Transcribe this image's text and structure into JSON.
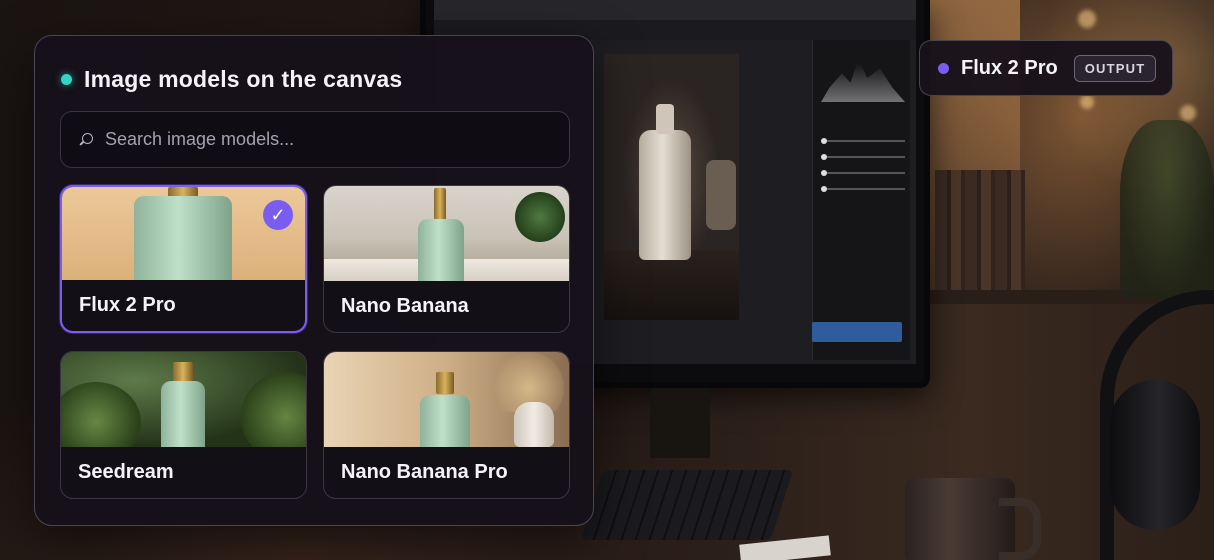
{
  "panel": {
    "title": "Image models on the canvas",
    "status_color": "#33d6c3",
    "search": {
      "placeholder": "Search image models..."
    },
    "models": [
      {
        "name": "Flux 2 Pro",
        "selected": true,
        "thumbnail": "green-bottle-warm-backdrop"
      },
      {
        "name": "Nano Banana",
        "selected": false,
        "thumbnail": "green-bottle-windowsill"
      },
      {
        "name": "Seedream",
        "selected": false,
        "thumbnail": "green-bottle-forest-ferns"
      },
      {
        "name": "Nano Banana Pro",
        "selected": false,
        "thumbnail": "green-bottle-dried-flowers"
      }
    ],
    "selected_icon": "check-icon",
    "accent_color": "#7b5cf0"
  },
  "output_chip": {
    "model_name": "Flux 2 Pro",
    "badge": "OUTPUT"
  }
}
